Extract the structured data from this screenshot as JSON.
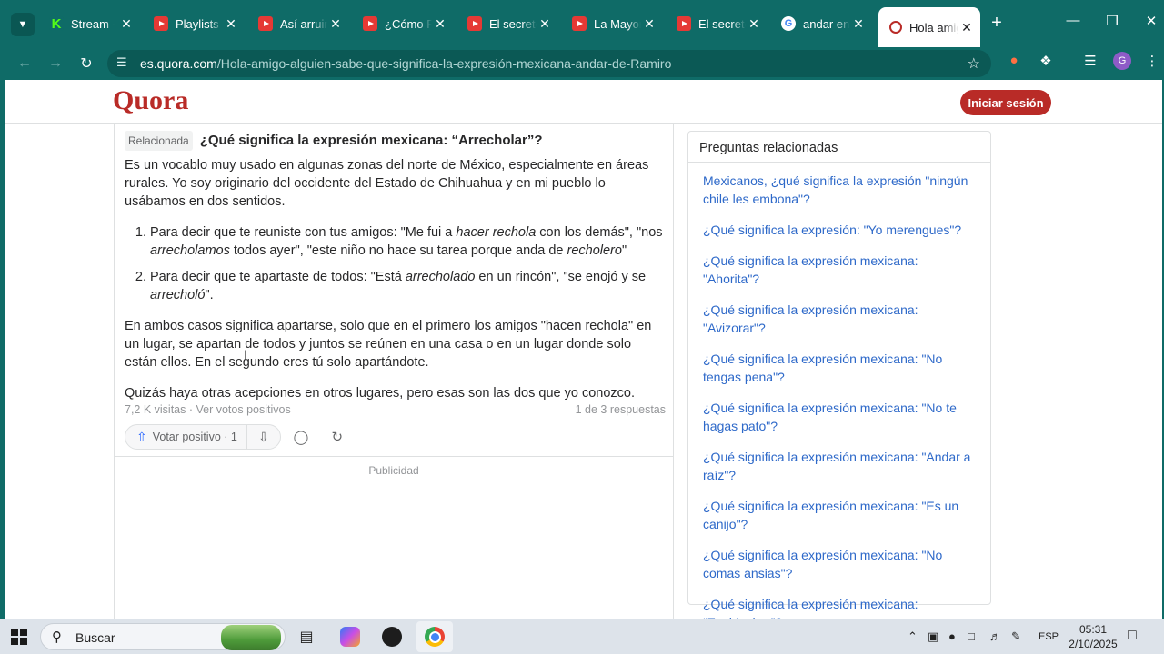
{
  "browser": {
    "tabs": [
      {
        "label": "Stream - K",
        "icon": "kick"
      },
      {
        "label": "Playlists -",
        "icon": "youtube"
      },
      {
        "label": "Así arruin",
        "icon": "youtube"
      },
      {
        "label": "¿Cómo Re",
        "icon": "youtube"
      },
      {
        "label": "El secreto",
        "icon": "youtube"
      },
      {
        "label": "La Mayor",
        "icon": "youtube"
      },
      {
        "label": "El secreto",
        "icon": "youtube"
      },
      {
        "label": "andar en",
        "icon": "google"
      },
      {
        "label": "Hola amig",
        "icon": "quora",
        "active": true
      }
    ],
    "url_host": "es.quora.com",
    "url_path": "/Hola-amigo-alguien-sabe-que-significa-la-expresión-mexicana-andar-de-Ramiro",
    "profile_initial": "G",
    "accent": "#0f6b67"
  },
  "quora": {
    "logo": "Quora",
    "login_button": "Iniciar sesión",
    "brand_color": "#b92b27"
  },
  "answer": {
    "related_badge": "Relacionada",
    "related_question": "¿Qué significa la expresión mexicana: “Arrecholar”?",
    "intro": "Es un vocablo muy usado en algunas zonas del norte de México, especialmente en áreas rurales. Yo soy originario del occidente del Estado de Chihuahua y en mi pueblo lo usábamos en dos sentidos.",
    "item1": {
      "a": "Para decir que te reuniste con tus amigos: \"Me fui a ",
      "b": "hacer rechola",
      "c": " con los demás\", \"nos ",
      "d": "arrecholamos",
      "e": " todos ayer\", \"este niño no hace su tarea porque anda de ",
      "f": "recholero",
      "g": "\""
    },
    "item2": {
      "a": "Para decir que te apartaste de todos: \"Está ",
      "b": "arrecholado",
      "c": " en un rincón\", \"se enojó y se ",
      "d": "arrecholó",
      "e": "\"."
    },
    "para2": "En ambos casos significa apartarse, solo que en el primero los amigos \"hacen rechola\" en un lugar, se apartan de todos y juntos se reúnen en una casa o en un lugar donde solo están ellos. En el segundo eres tú solo apartándote.",
    "para3": "Quizás haya otras acepciones en otros lugares, pero esas son las dos que yo conozco.",
    "views": "7,2 K visitas · Ver votos positivos",
    "answer_count": "1 de 3 respuestas",
    "upvote_label": "Votar positivo · 1",
    "ad_label": "Publicidad"
  },
  "sidebar": {
    "title": "Preguntas relacionadas",
    "links": [
      "Mexicanos, ¿qué significa la expresión \"ningún chile les embona\"?",
      "¿Qué significa la expresión: \"Yo merengues\"?",
      "¿Qué significa la expresión mexicana: \"Ahorita\"?",
      "¿Qué significa la expresión mexicana: \"Avizorar\"?",
      "¿Qué significa la expresión mexicana: \"No tengas pena\"?",
      "¿Qué significa la expresión mexicana: \"No te hagas pato\"?",
      "¿Qué significa la expresión mexicana: \"Andar a raíz\"?",
      "¿Qué significa la expresión mexicana: \"Es un canijo\"?",
      "¿Qué significa la expresión mexicana: \"No comas ansias\"?",
      "¿Qué significa la expresión mexicana: “Enchinchar”?"
    ]
  },
  "taskbar": {
    "search_placeholder": "Buscar",
    "language": "ESP",
    "time": "05:31",
    "date": "2/10/2025"
  }
}
